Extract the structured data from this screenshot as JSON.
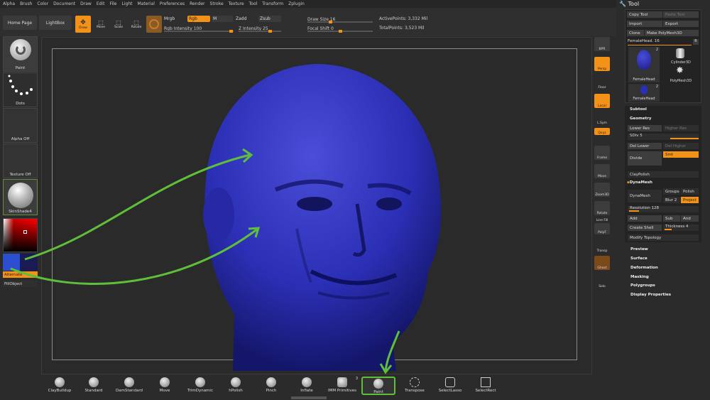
{
  "menu": [
    "Alpha",
    "Brush",
    "Color",
    "Document",
    "Draw",
    "Edit",
    "File",
    "Light",
    "Material",
    "Preferences",
    "Render",
    "Stroke",
    "Texture",
    "Tool",
    "Transform",
    "Zplugin"
  ],
  "topbar": {
    "home_page": "Home Page",
    "lightbox": "LightBox",
    "draw": "Draw",
    "move": "Move",
    "scale": "Scale",
    "rotate": "Rotate",
    "mrgb": "Mrgb",
    "rgb": "Rgb",
    "m": "M",
    "zadd": "Zadd",
    "zsub": "Zsub",
    "rgb_intensity": "Rgb Intensity 100",
    "z_intensity": "Z Intensity 25",
    "draw_size": "Draw Size 16",
    "focal_shift": "Focal Shift 0",
    "active_points": "ActivePoints: 3,332 Mil",
    "total_points": "TotalPoints: 3,523 Mil"
  },
  "left": {
    "paint": "Paint",
    "dots": "Dots",
    "alpha_off": "Alpha Off",
    "texture_off": "Texture Off",
    "material": "SkinShade4",
    "alternate": "Alternate",
    "fill_object": "FillObject"
  },
  "right_tools": [
    "BPR",
    "Persp",
    "Floor",
    "Local",
    "L.Sym",
    "Qxyz",
    "Frame",
    "Move",
    "Zoom3D",
    "Rotate",
    "Line Fill",
    "PolyF",
    "Transp",
    "Ghost",
    "Solo"
  ],
  "tool": {
    "title": "Tool",
    "copy_tool": "Copy Tool",
    "paste_tool": "Paste Tool",
    "import": "Import",
    "export": "Export",
    "clone": "Clone",
    "make_polymesh": "Make PolyMesh3D",
    "current": "FemaleHead. 16",
    "r": "R",
    "thumb1": "FemaleHead",
    "thumb1_count": "2",
    "thumb2": "Cylinder3D",
    "thumb3": "PolyMesh3D",
    "thumb4": "FemaleHead",
    "thumb4_count": "2",
    "subtool": "Subtool",
    "geometry": "Geometry",
    "lower_res": "Lower Res",
    "higher_res": "Higher Res",
    "sdiv": "SDiv 5",
    "del_lower": "Del Lower",
    "del_higher": "Del Higher",
    "divide": "Divide",
    "smt": "Smt",
    "claypolish": "ClayPolish",
    "dynamesh_head": "DynaMesh",
    "dynamesh": "DynaMesh",
    "groups": "Groups",
    "polish": "Polish",
    "blur": "Blur 2",
    "project": "Project",
    "resolution": "Resolution 128",
    "add": "Add",
    "sub": "Sub",
    "and": "And",
    "create_shell": "Create Shell",
    "thickness": "Thickness 4",
    "modify_topology": "Modify Topology",
    "sections": [
      "Preview",
      "Surface",
      "Deformation",
      "Masking",
      "Polygroups",
      "Display Properties"
    ]
  },
  "brushes": [
    "ClayBuildup",
    "Standard",
    "DamStandard",
    "Move",
    "TrimDynamic",
    "hPolish",
    "Pinch",
    "Inflate",
    "IMM Primitives",
    "Paint",
    "Transpose",
    "SelectLasso",
    "SelectRect"
  ],
  "imm_count": "3",
  "colors": {
    "accent": "#f29219",
    "model": "#2b2fb5",
    "arrow": "#5fbf3a"
  }
}
